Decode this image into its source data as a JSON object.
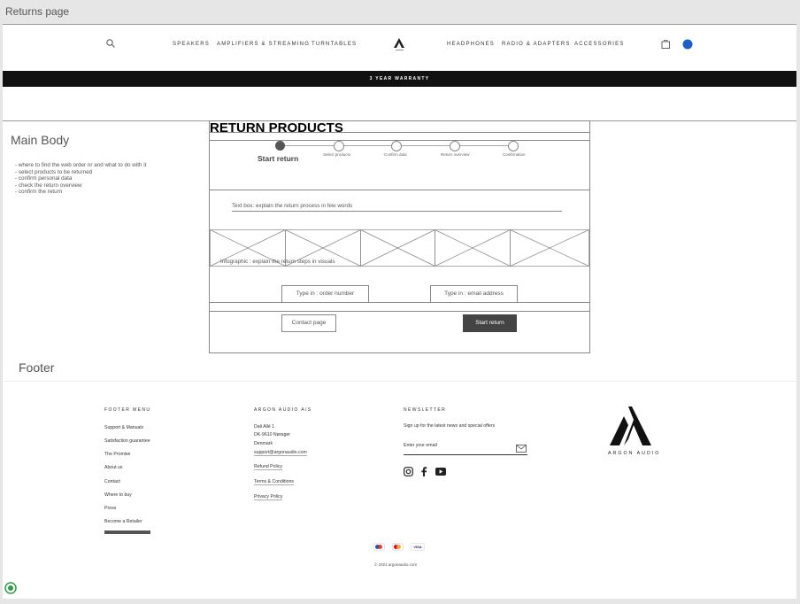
{
  "window": {
    "title": "Returns page"
  },
  "header": {
    "nav_left": [
      "SPEAKERS",
      "AMPLIFIERS & STREAMING",
      "TURNTABLES"
    ],
    "nav_right": [
      "HEADPHONES",
      "RADIO & ADAPTERS",
      "ACCESSORIES"
    ],
    "banner": "3 YEAR WARRANTY",
    "icons": [
      "search-icon",
      "logo",
      "bag-icon",
      "globe-icon"
    ]
  },
  "main": {
    "section_label": "Main Body",
    "notes": "- where to find the web order nr and what to do with it\n- select products to be returned\n- confirm personal data\n- check the return overview\n- confirm the return",
    "title": "RETURN PRODUCTS",
    "steps": [
      {
        "label": "Start return",
        "active": true
      },
      {
        "label": "Select products",
        "active": false
      },
      {
        "label": "Confirm data",
        "active": false
      },
      {
        "label": "Return overview",
        "active": false
      },
      {
        "label": "Confirmation",
        "active": false
      }
    ],
    "textbox": "Text  box: explain the return process in few words",
    "infographic": "Infographic : explain the return steps in visuals",
    "order_placeholder": "Type in : order number",
    "email_placeholder": "Type in : email address",
    "contact_button": "Contact page",
    "start_button": "Start return"
  },
  "footer": {
    "section_label": "Footer",
    "menu_heading": "FOOTER MENU",
    "menu": [
      "Support & Manuals",
      "Satisfaction guarantee",
      "The Promise",
      "About us",
      "Contact",
      "Where to buy",
      "Press",
      "Become a Retailer"
    ],
    "company_heading": "ARGON AUDIO A/S",
    "address": [
      "Dali Allé 1",
      "DK-9610 Nørager",
      "Denmark",
      "support@argonaudio.com"
    ],
    "company_links": [
      "Refund Policy",
      "Terms & Conditions",
      "Privacy Policy"
    ],
    "newsletter_heading": "NEWSLETTER",
    "newsletter_text": "Sign up for the latest news and special offers",
    "email_placeholder": "Enter your email",
    "logo_text": "ARGON AUDIO",
    "payments": [
      "Maestro",
      "Mastercard",
      "VISA"
    ],
    "copyright": "© 2021 argonaudio.com"
  }
}
